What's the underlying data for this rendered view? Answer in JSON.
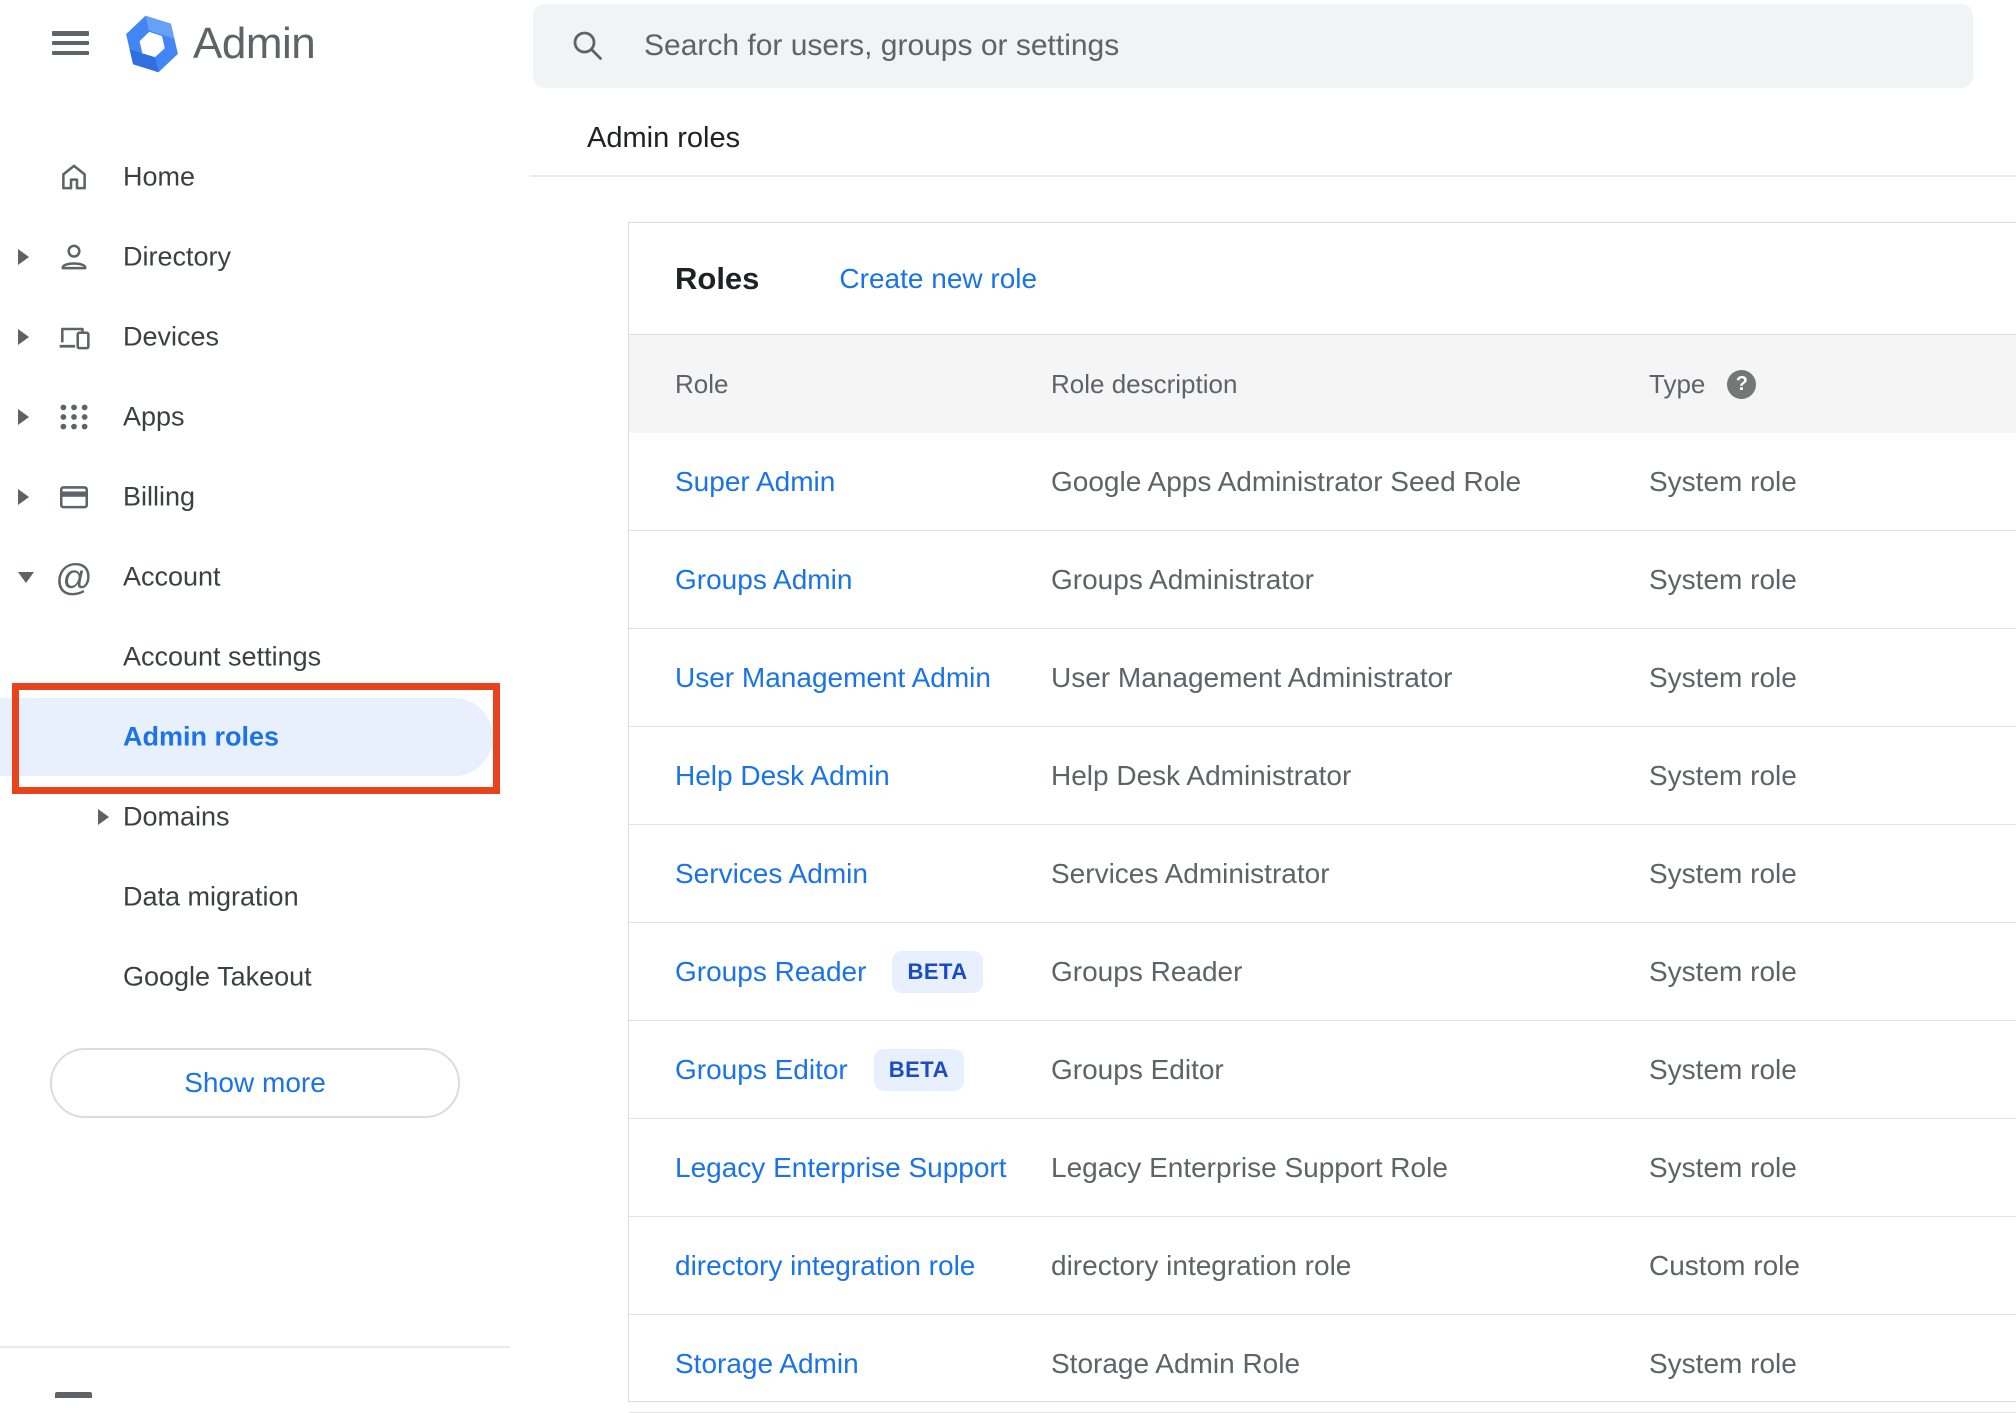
{
  "app": {
    "name": "Admin"
  },
  "search": {
    "placeholder": "Search for users, groups or settings"
  },
  "breadcrumb": "Admin roles",
  "sidebar": {
    "items": [
      {
        "label": "Home"
      },
      {
        "label": "Directory"
      },
      {
        "label": "Devices"
      },
      {
        "label": "Apps"
      },
      {
        "label": "Billing"
      },
      {
        "label": "Account"
      },
      {
        "label": "Account settings"
      },
      {
        "label": "Admin roles",
        "selected": true
      },
      {
        "label": "Domains"
      },
      {
        "label": "Data migration"
      },
      {
        "label": "Google Takeout"
      }
    ],
    "show_more_label": "Show more"
  },
  "roles_panel": {
    "title": "Roles",
    "create_link": "Create new role",
    "columns": {
      "role": "Role",
      "description": "Role description",
      "type": "Type"
    },
    "rows": [
      {
        "role": "Super Admin",
        "description": "Google Apps Administrator Seed Role",
        "type": "System role"
      },
      {
        "role": "Groups Admin",
        "description": "Groups Administrator",
        "type": "System role"
      },
      {
        "role": "User Management Admin",
        "description": "User Management Administrator",
        "type": "System role"
      },
      {
        "role": "Help Desk Admin",
        "description": "Help Desk Administrator",
        "type": "System role"
      },
      {
        "role": "Services Admin",
        "description": "Services Administrator",
        "type": "System role"
      },
      {
        "role": "Groups Reader",
        "badge": "BETA",
        "description": "Groups Reader",
        "type": "System role"
      },
      {
        "role": "Groups Editor",
        "badge": "BETA",
        "description": "Groups Editor",
        "type": "System role"
      },
      {
        "role": "Legacy Enterprise Support",
        "description": "Legacy Enterprise Support Role",
        "type": "System role"
      },
      {
        "role": "directory integration role",
        "description": "directory integration role",
        "type": "Custom role"
      },
      {
        "role": "Storage Admin",
        "description": "Storage Admin Role",
        "type": "System role"
      }
    ]
  },
  "icons": {
    "help_glyph": "?"
  },
  "colors": {
    "accent_blue": "#1a73e8",
    "selected_item_bg": "#e8f0fe",
    "annotation_red": "#e8431c",
    "badge_bg": "#e8f0fe",
    "badge_text": "#1b4ac5",
    "table_header_bg": "#f5f5f5",
    "muted_text": "#5f6368",
    "logo_blue": "#4285f4"
  }
}
